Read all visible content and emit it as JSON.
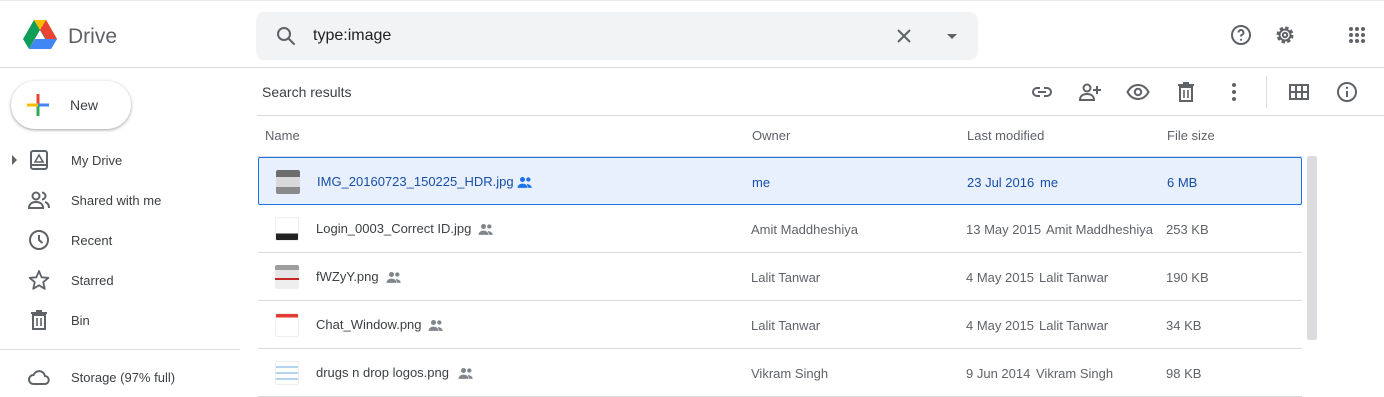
{
  "header": {
    "brand": "Drive",
    "search_value": "type:image"
  },
  "sidebar": {
    "new_label": "New",
    "items": [
      {
        "label": "My Drive",
        "icon": "my-drive-icon"
      },
      {
        "label": "Shared with me",
        "icon": "shared-icon"
      },
      {
        "label": "Recent",
        "icon": "clock-icon"
      },
      {
        "label": "Starred",
        "icon": "star-icon"
      },
      {
        "label": "Bin",
        "icon": "trash-icon"
      }
    ],
    "storage_label": "Storage (97% full)"
  },
  "main": {
    "title": "Search results",
    "columns": {
      "name": "Name",
      "owner": "Owner",
      "modified": "Last modified",
      "size": "File size"
    },
    "rows": [
      {
        "name": "IMG_20160723_150225_HDR.jpg",
        "owner": "me",
        "modified_date": "23 Jul 2016",
        "modified_by": "me",
        "size": "6 MB",
        "selected": true
      },
      {
        "name": "Login_0003_Correct ID.jpg",
        "owner": "Amit Maddheshiya",
        "modified_date": "13 May 2015",
        "modified_by": "Amit Maddheshiya",
        "size": "253 KB",
        "selected": false
      },
      {
        "name": "fWZyY.png",
        "owner": "Lalit Tanwar",
        "modified_date": "4 May 2015",
        "modified_by": "Lalit Tanwar",
        "size": "190 KB",
        "selected": false
      },
      {
        "name": "Chat_Window.png",
        "owner": "Lalit Tanwar",
        "modified_date": "4 May 2015",
        "modified_by": "Lalit Tanwar",
        "size": "34 KB",
        "selected": false
      },
      {
        "name": "drugs n drop logos.png",
        "owner": "Vikram Singh",
        "modified_date": "9 Jun 2014",
        "modified_by": "Vikram Singh",
        "size": "98 KB",
        "selected": false
      }
    ]
  },
  "colors": {
    "accent": "#1a73e8",
    "selected_bg": "#e8f0fe",
    "icon": "#5f6368"
  }
}
